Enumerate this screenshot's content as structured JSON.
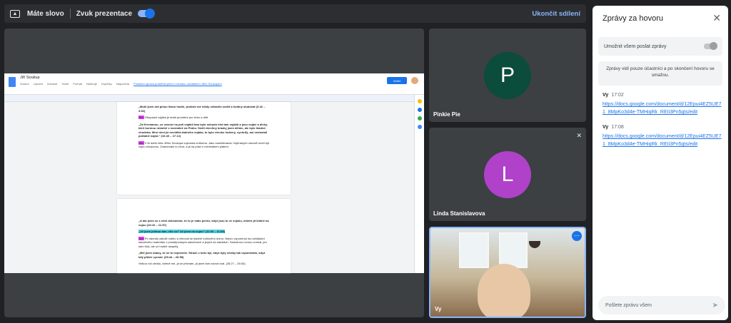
{
  "topbar": {
    "presenting_label": "Máte slovo",
    "sound_label": "Zvuk prezentace",
    "stop_label": "Ukončit sdílení"
  },
  "doc": {
    "title": "Jiří Soukup",
    "menu": [
      "Soubor",
      "Upravit",
      "Zobrazit",
      "Vložit",
      "Formát",
      "Nástroje",
      "Doplňky",
      "Nápověda"
    ],
    "last_edit": "Poslední úprava proběhla před 1 minutou uživatelem Jiřím Soukupem",
    "share_label": "Sdílet",
    "p1": "„Mohl jsem mít plnou hlavu hodin, protože mě nikdy nebavilo sedět a hodiny studovat (3:42 – 3:52)",
    "tag1": "Obr.",
    "p2": "Obupsání vojáka je malá proměna pro ženu a dítě.",
    "p3": "„Za Kremanou, co vesnicí na poli vojáků tam bylo nebudu hlet tam vojáků a jsou vojáci a dívky, kteří kormou robotně v normálně na Prahu. Sedíl všechny krasky jsem dělnic, ale bylo hladné, chudoba. Mezi nimi jsi neviděla žádného vojáka, to bylo všecko hubený, vychrtlý, ani nedostali pořádně najíst.“ (16:40 – 17:12)",
    "tag2": "Obr.",
    "p4": "V té době četa Jiřího Soukupa vojenská uniforma. Jako zaměstnanec Vojenských závodů mohl být vojnu zbrojovou. Znamenalo to život, a já na práci s minimálním platem.",
    "p5": "„A tak jsem se s nimi dohodoval, že to je málo peněz, když jsou to ve vojsku, můžeš jít klidně na vojnu (10:10 – 11:57)",
    "p6": "„Už jsem jednou tam, víte co? Už jsem na vojnu“ (11:03 – 11:08)",
    "tag3": "Obr.",
    "p7": "Po návratu založil rodinu a věnoval se stavbě rodinného domu. Nejvíc vzpomínal na rozkládání stavebního materiálu v prostějovských stavebních a jiných na stavbách. Samotnou rovnou vnímal, jen sám říká, ale už hodně dospělý.",
    "p8": "„Měl jsem obavy, že se to nepovede. Strach z toho byl, když byly sestky tak vzpomínám, když bílý příběr vyrostl. (25:44 – 26:55)",
    "p9": "Velkou roli uhrála, včetně mé, já se přiznám, já jsem tam odvod vzal. (26:27 – 26:53)"
  },
  "participants": [
    {
      "name": "Pinkie Pie",
      "initial": "P",
      "color": "#0b4c3c"
    },
    {
      "name": "Linda Stanislavova",
      "initial": "L",
      "color": "#b041c9"
    },
    {
      "name": "Vy"
    }
  ],
  "chat": {
    "title": "Zprávy za hovoru",
    "allow_label": "Umožnit všem poslat zprávy",
    "info": "Zprávy vidí pouze účastníci a po skončení hovoru se smažou.",
    "messages": [
      {
        "sender": "Vy",
        "time": "17:02",
        "link": "https://docs.google.com/document/d/12Epui4EZ5UE71_8MpKo3d4e-TMHiqRk_REIi3Pn5gts/edit"
      },
      {
        "sender": "Vy",
        "time": "17:08",
        "link": "https://docs.google.com/document/d/12Epui4EZ5UE71_8MpKo3d4e-TMHiqRk_REIi3Pn5gts/edit"
      }
    ],
    "input_placeholder": "Pošlete zprávu všem"
  }
}
